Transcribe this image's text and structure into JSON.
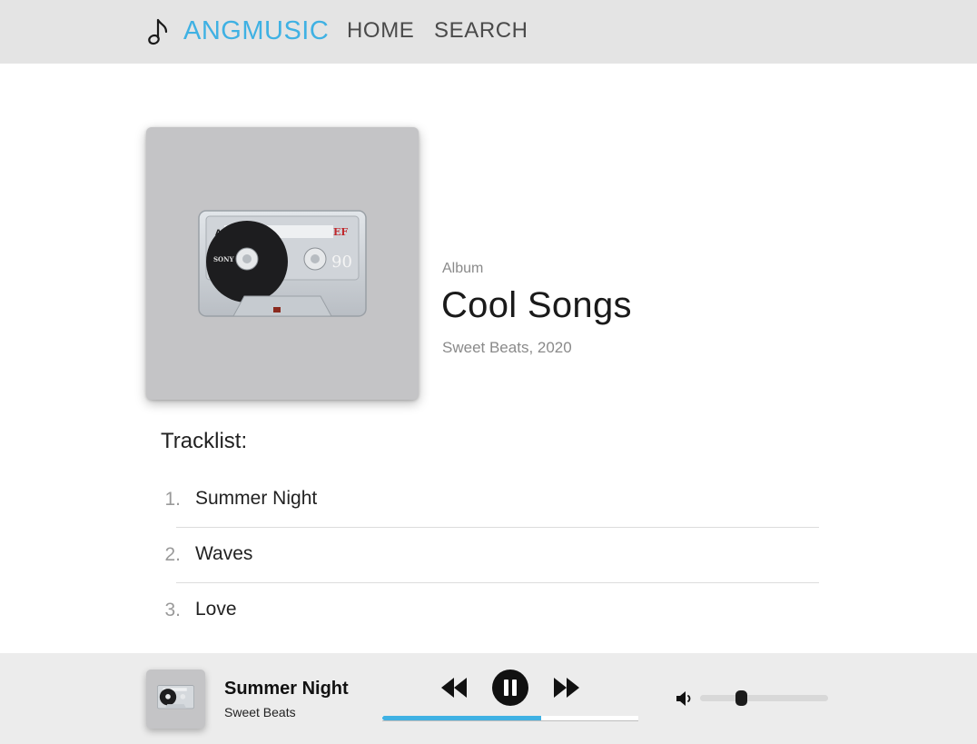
{
  "nav": {
    "brand": "ANGMUSIC",
    "brand_icon": "music-note-icon",
    "links": [
      {
        "label": "HOME"
      },
      {
        "label": "SEARCH"
      }
    ]
  },
  "album": {
    "kind": "Album",
    "title": "Cool Songs",
    "meta": "Sweet Beats, 2020",
    "cover_icon": "cassette-tape-image"
  },
  "tracklist": {
    "heading": "Tracklist:",
    "tracks": [
      {
        "number": "1.",
        "title": "Summer Night"
      },
      {
        "number": "2.",
        "title": "Waves"
      },
      {
        "number": "3.",
        "title": "Love"
      }
    ]
  },
  "player": {
    "title": "Summer Night",
    "artist": "Sweet Beats",
    "state": "playing",
    "progress_fraction": 0.62,
    "volume_fraction": 0.32,
    "icons": {
      "previous": "rewind-icon",
      "pause": "pause-icon",
      "next": "fast-forward-icon",
      "volume": "volume-icon"
    }
  },
  "colors": {
    "accent": "#3fb1e3",
    "nav_background": "#e4e4e4",
    "player_background": "#ececec",
    "cover_background": "#c4c4c6"
  }
}
